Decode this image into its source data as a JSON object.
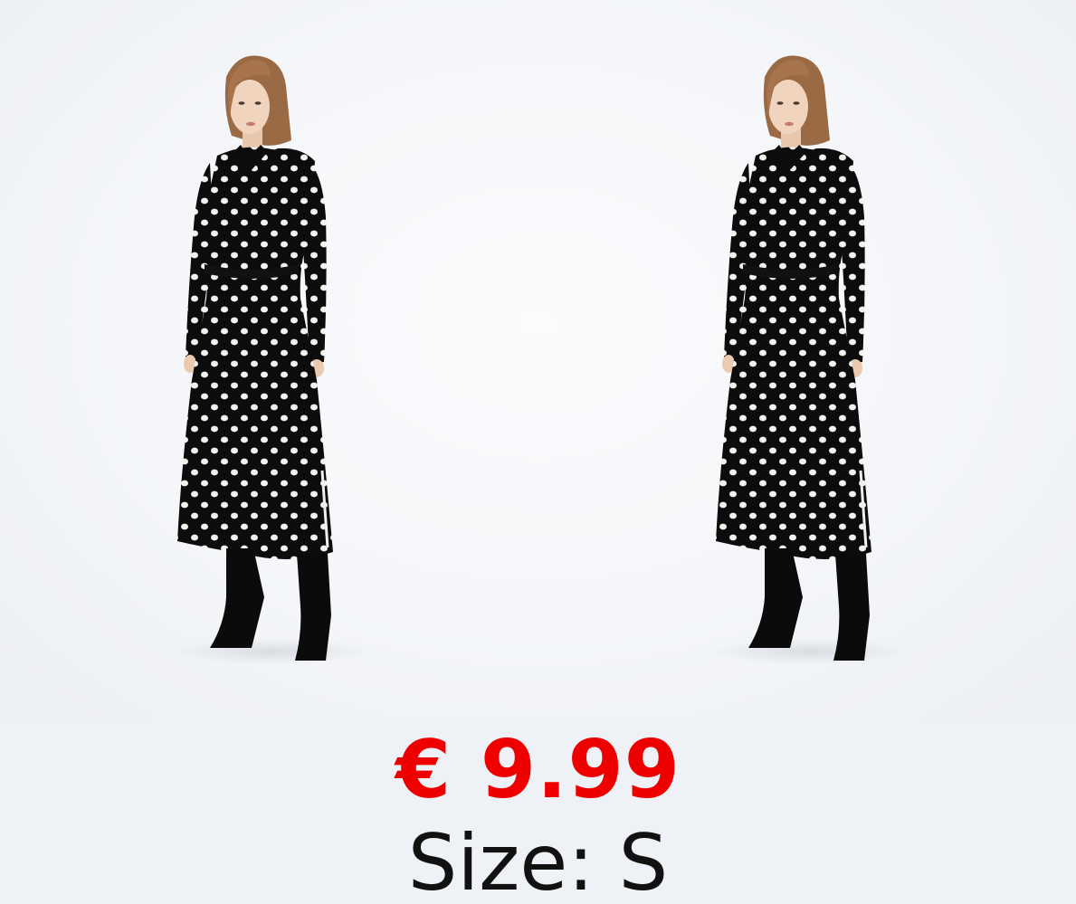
{
  "product": {
    "price": "€ 9.99",
    "size": "Size: S",
    "price_color": "#ee0000"
  },
  "images": [
    {
      "description_icon": "model-photo-icon"
    },
    {
      "description_icon": "model-photo-icon"
    }
  ]
}
